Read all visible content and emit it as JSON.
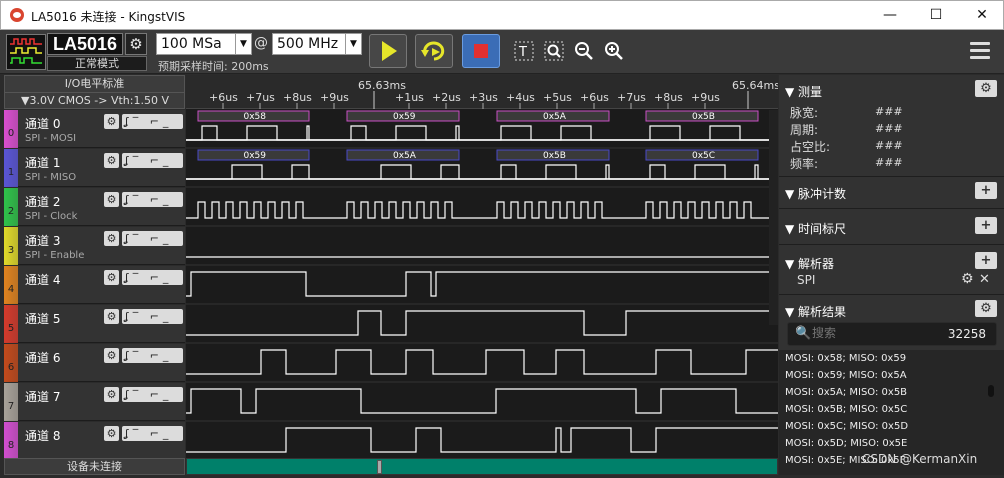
{
  "window": {
    "title": "LA5016 未连接 - KingstVIS",
    "minimize": "—",
    "maximize": "☐",
    "close": "✕"
  },
  "toolbar": {
    "device_name": "LA5016",
    "device_mode": "正常模式",
    "sample_depth": "100 MSa",
    "at": "@",
    "sample_rate": "500 MHz",
    "pre_time": "预期采样时间: 200ms"
  },
  "left": {
    "io_standard": "I/O电平标准",
    "level_setting": "▼3.0V CMOS  -> Vth:1.50 V",
    "status": "设备未连接"
  },
  "channels": [
    {
      "num": "0",
      "name": "通道 0",
      "sub": "SPI - MOSI",
      "color": "#d94fd0"
    },
    {
      "num": "1",
      "name": "通道 1",
      "sub": "SPI - MISO",
      "color": "#5a55d6"
    },
    {
      "num": "2",
      "name": "通道 2",
      "sub": "SPI - Clock",
      "color": "#2fc24a"
    },
    {
      "num": "3",
      "name": "通道 3",
      "sub": "SPI - Enable",
      "color": "#e0d92a"
    },
    {
      "num": "4",
      "name": "通道 4",
      "sub": "",
      "color": "#e0831f"
    },
    {
      "num": "5",
      "name": "通道 5",
      "sub": "",
      "color": "#d43a2c"
    },
    {
      "num": "6",
      "name": "通道 6",
      "sub": "",
      "color": "#c24a1c"
    },
    {
      "num": "7",
      "name": "通道 7",
      "sub": "",
      "color": "#a8a29a"
    },
    {
      "num": "8",
      "name": "通道 8",
      "sub": "",
      "color": "#d24fd0"
    }
  ],
  "ruler": {
    "major": [
      "65.63ms",
      "65.64ms"
    ],
    "ticks": [
      "+6us",
      "+7us",
      "+8us",
      "+9us",
      "+1us",
      "+2us",
      "+3us",
      "+4us",
      "+5us",
      "+6us",
      "+7us",
      "+8us",
      "+9us"
    ]
  },
  "mosi_bytes": [
    "0x58",
    "0x59",
    "0x5A",
    "0x5B"
  ],
  "miso_bytes": [
    "0x59",
    "0x5A",
    "0x5B",
    "0x5C"
  ],
  "right": {
    "measure": "测量",
    "pulse_width": "脉宽:",
    "period": "周期:",
    "duty": "占空比:",
    "freq": "频率:",
    "na": "###",
    "pulse_count": "脉冲计数",
    "time_ruler": "时间标尺",
    "analyzer": "解析器",
    "analyzer_item": "SPI",
    "results": "解析结果",
    "search_placeholder": "搜索",
    "result_count": "32258",
    "result_items": [
      "MOSI: 0x58;  MISO: 0x59",
      "MOSI: 0x59;  MISO: 0x5A",
      "MOSI: 0x5A;  MISO: 0x5B",
      "MOSI: 0x5B;  MISO: 0x5C",
      "MOSI: 0x5C;  MISO: 0x5D",
      "MOSI: 0x5D;  MISO: 0x5E",
      "MOSI: 0x5E;  MISO: 0x5F"
    ]
  },
  "watermark": "CSDN @KermanXin"
}
